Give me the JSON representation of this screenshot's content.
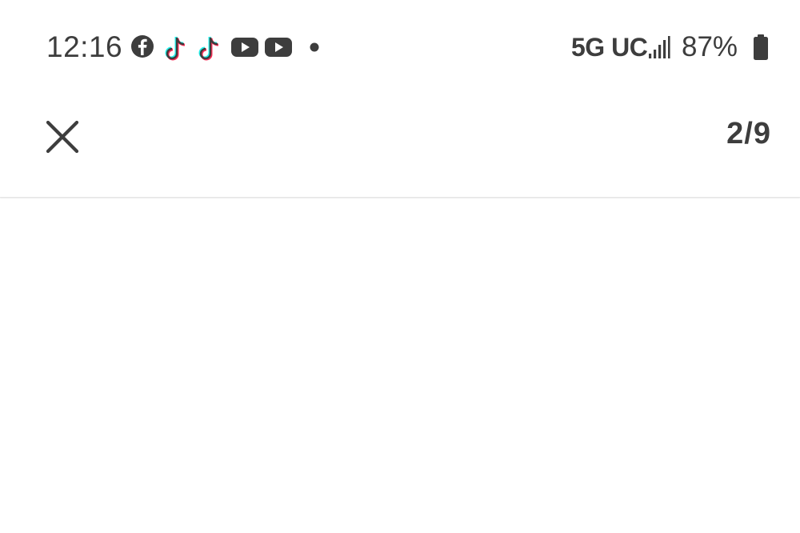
{
  "status_bar": {
    "time": "12:16",
    "notification_icons": [
      "facebook-icon",
      "tiktok-icon",
      "tiktok-icon",
      "youtube-icon",
      "youtube-icon",
      "more-dot-icon"
    ],
    "network": "5G UC",
    "battery_percent": "87%"
  },
  "app_bar": {
    "close_icon": "close-icon",
    "page_counter": "2/9"
  },
  "colors": {
    "icon": "#3d3d3d",
    "background": "#ffffff",
    "tiktok_cyan": "#25f4ee",
    "tiktok_red": "#fe2c55"
  }
}
